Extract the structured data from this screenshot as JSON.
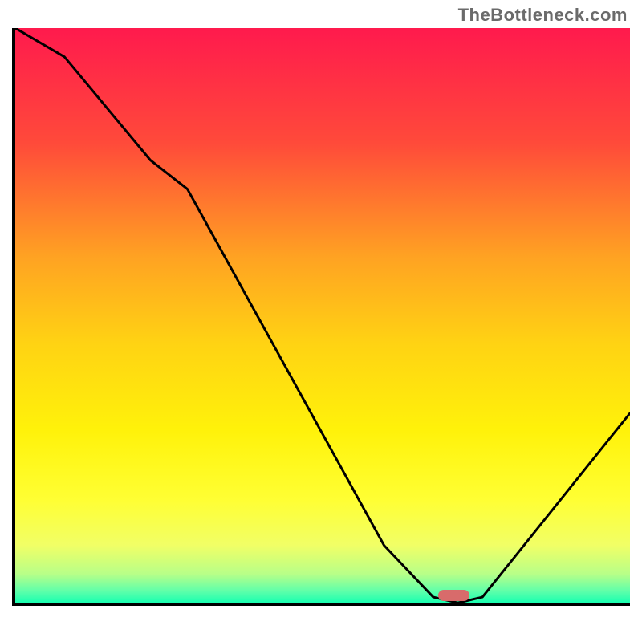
{
  "watermark": "TheBottleneck.com",
  "chart_data": {
    "type": "line",
    "title": "",
    "xlabel": "",
    "ylabel": "",
    "xlim": [
      0,
      100
    ],
    "ylim": [
      0,
      100
    ],
    "x": [
      0,
      8,
      15,
      22,
      28,
      60,
      68,
      72,
      76,
      100
    ],
    "values": [
      100,
      95,
      86,
      77,
      72,
      10,
      1,
      0,
      1,
      33
    ],
    "gradient_stops": [
      {
        "t": 0.0,
        "c": "#ff1a4d"
      },
      {
        "t": 0.2,
        "c": "#ff4a3a"
      },
      {
        "t": 0.4,
        "c": "#ffa322"
      },
      {
        "t": 0.55,
        "c": "#ffd313"
      },
      {
        "t": 0.7,
        "c": "#fff20a"
      },
      {
        "t": 0.82,
        "c": "#ffff33"
      },
      {
        "t": 0.9,
        "c": "#f1ff66"
      },
      {
        "t": 0.95,
        "c": "#b8ff88"
      },
      {
        "t": 0.98,
        "c": "#5fffaa"
      },
      {
        "t": 1.0,
        "c": "#1affb0"
      }
    ],
    "marker": {
      "x": 71,
      "y": 0,
      "w": 5
    }
  }
}
